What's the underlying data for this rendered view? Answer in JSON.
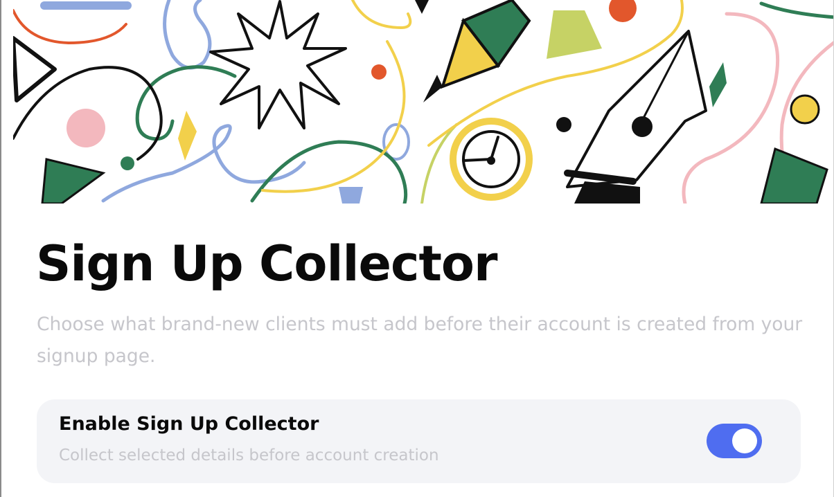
{
  "page": {
    "title": "Sign Up Collector",
    "subtitle": "Choose what brand-new clients must add before their account is created from your signup page."
  },
  "setting": {
    "title": "Enable Sign Up Collector",
    "description": "Collect selected details before account creation",
    "enabled": true
  },
  "colors": {
    "toggle_on": "#4f6df0",
    "card_background": "#f3f4f7",
    "muted_text": "#c6c6cb",
    "illustration": [
      "#e2572c",
      "#f2d04b",
      "#2f7d55",
      "#8fa8de",
      "#f3b8be",
      "#c6d265",
      "#111111"
    ]
  }
}
